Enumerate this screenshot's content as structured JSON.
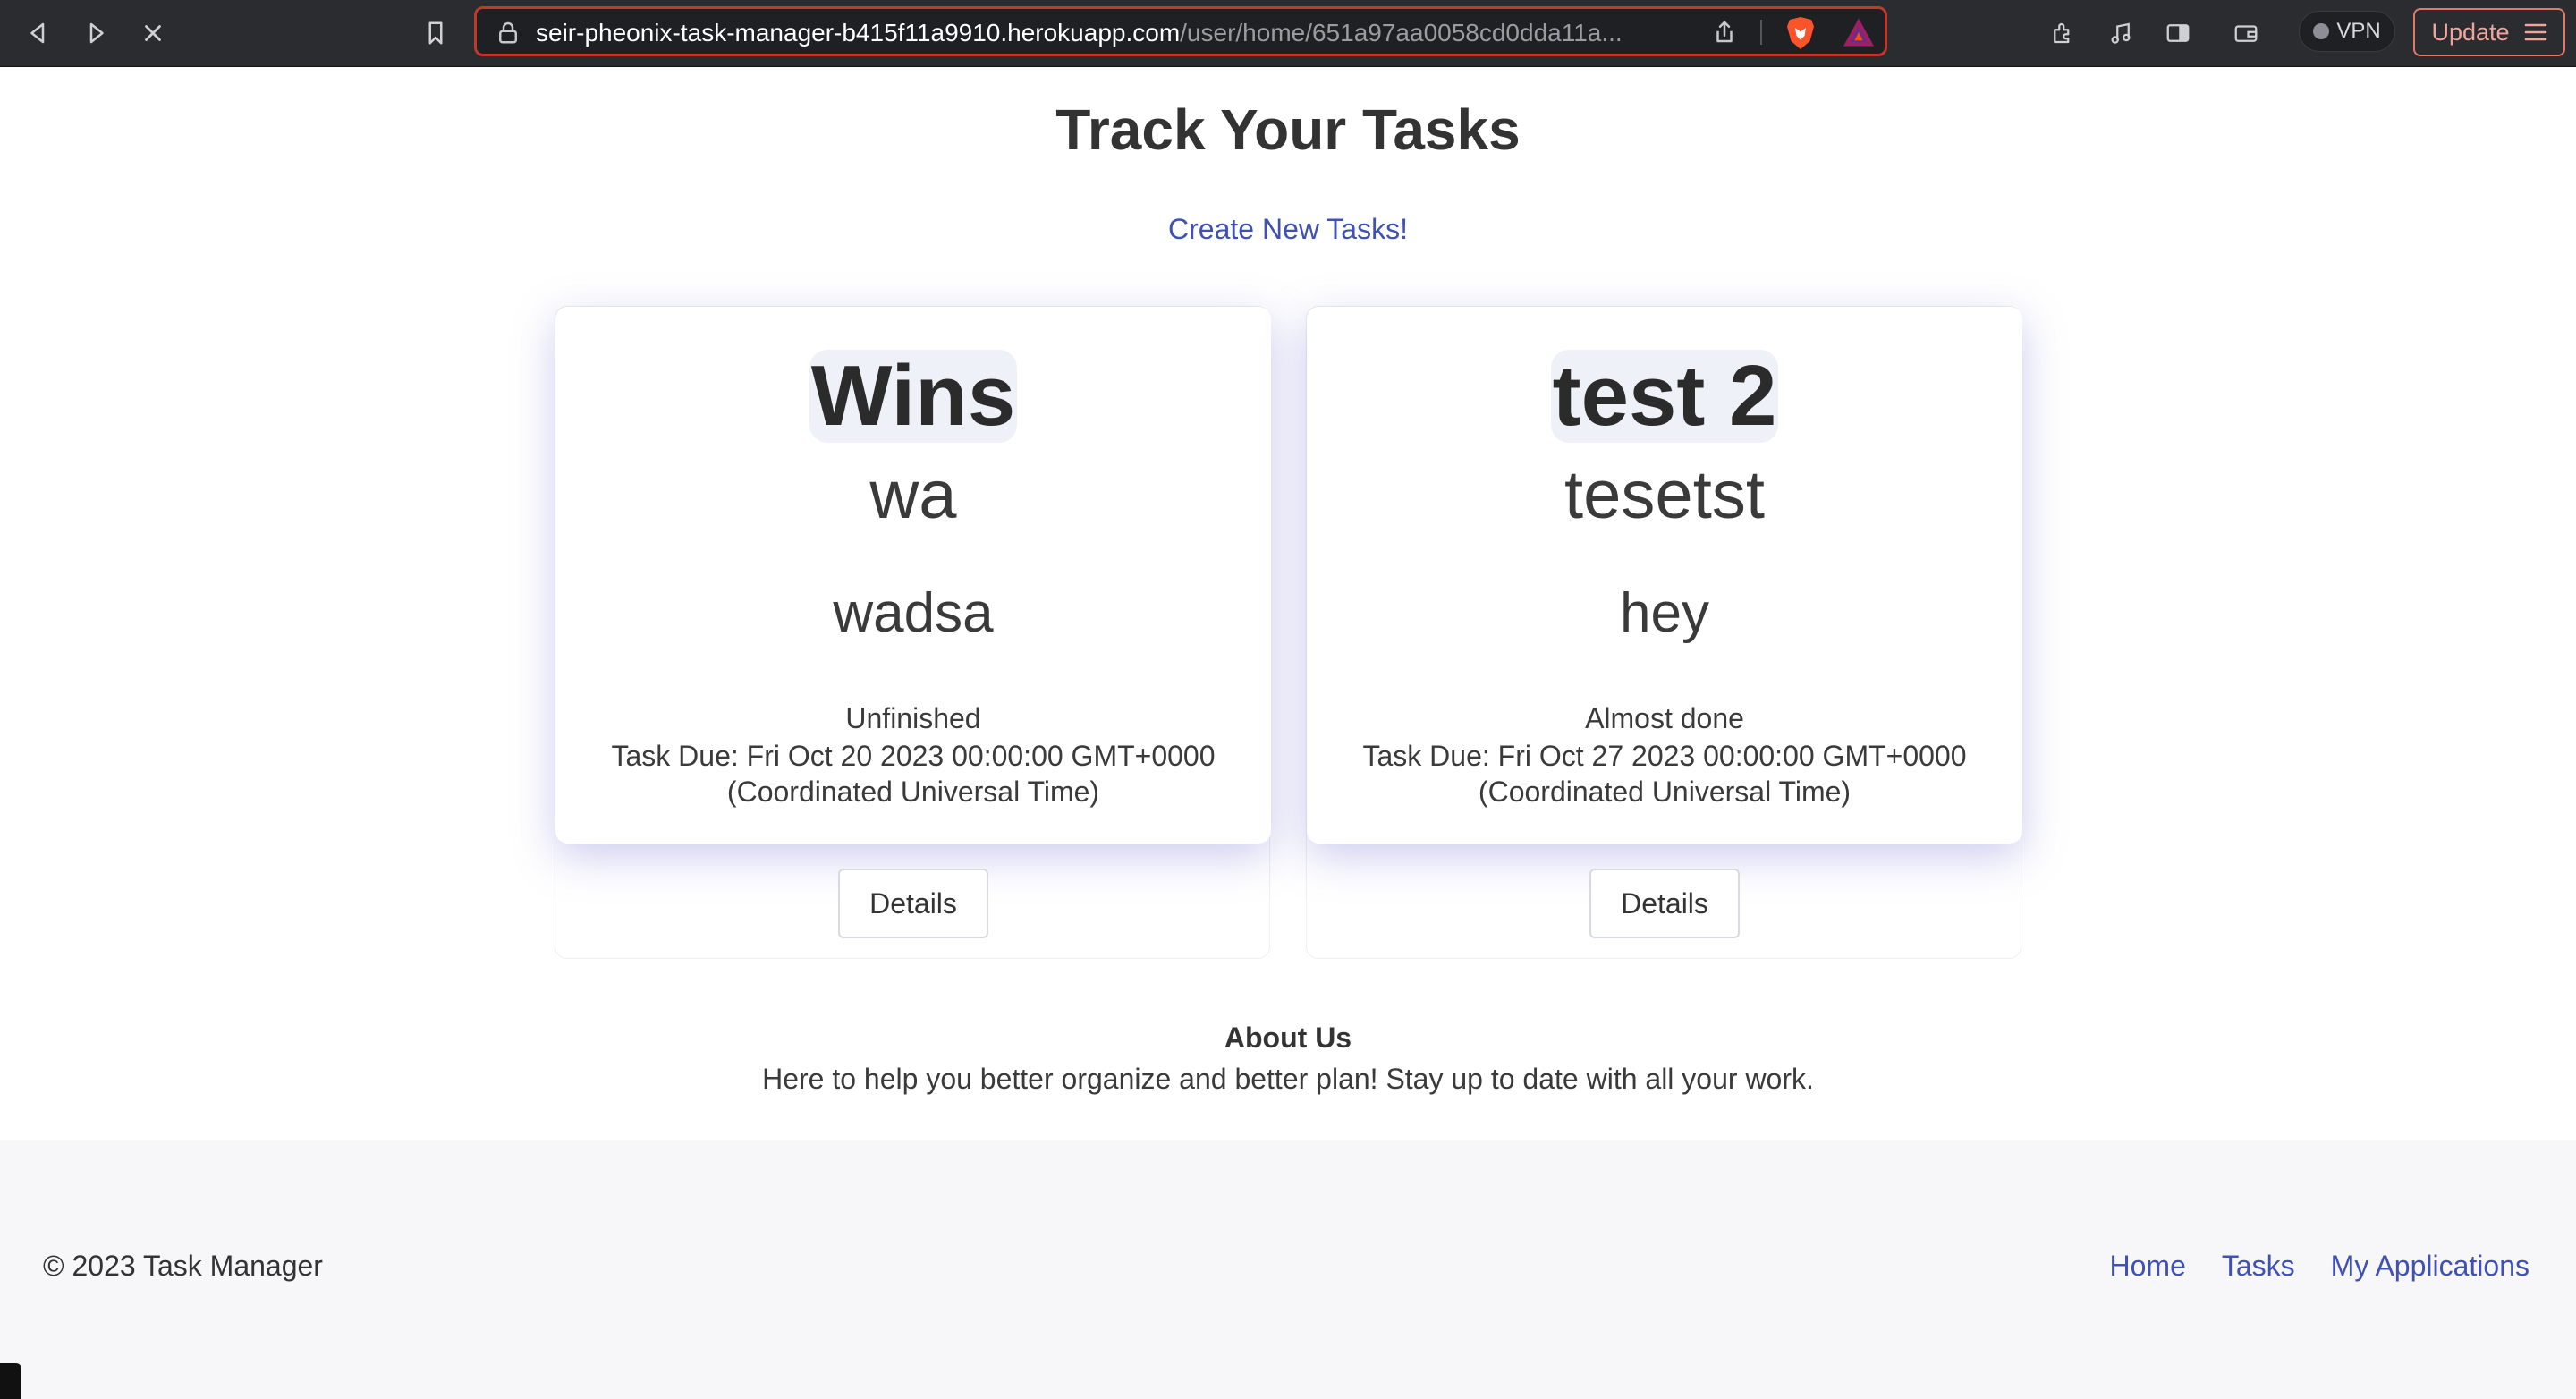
{
  "browser": {
    "url_host": "seir-pheonix-task-manager-b415f11a9910.herokuapp.com",
    "url_path": "/user/home/651a97aa0058cd0dda11a...",
    "vpn_label": "VPN",
    "update_label": "Update"
  },
  "page": {
    "title": "Track Your Tasks",
    "create_link": "Create New Tasks!"
  },
  "tasks": [
    {
      "name": "Wins",
      "subtitle": "wa",
      "note": "wadsa",
      "status": "Unfinished",
      "due": "Task Due: Fri Oct 20 2023 00:00:00 GMT+0000 (Coordinated Universal Time)",
      "details_label": "Details"
    },
    {
      "name": "test 2",
      "subtitle": "tesetst",
      "note": "hey",
      "status": "Almost done",
      "due": "Task Due: Fri Oct 27 2023 00:00:00 GMT+0000 (Coordinated Universal Time)",
      "details_label": "Details"
    }
  ],
  "about": {
    "title": "About Us",
    "text": "Here to help you better organize and better plan! Stay up to date with all your work."
  },
  "footer": {
    "copyright": "© 2023 Task Manager",
    "links": [
      "Home",
      "Tasks",
      "My Applications"
    ]
  },
  "colors": {
    "link": "#3f51b5",
    "update_border": "#e0786c"
  }
}
